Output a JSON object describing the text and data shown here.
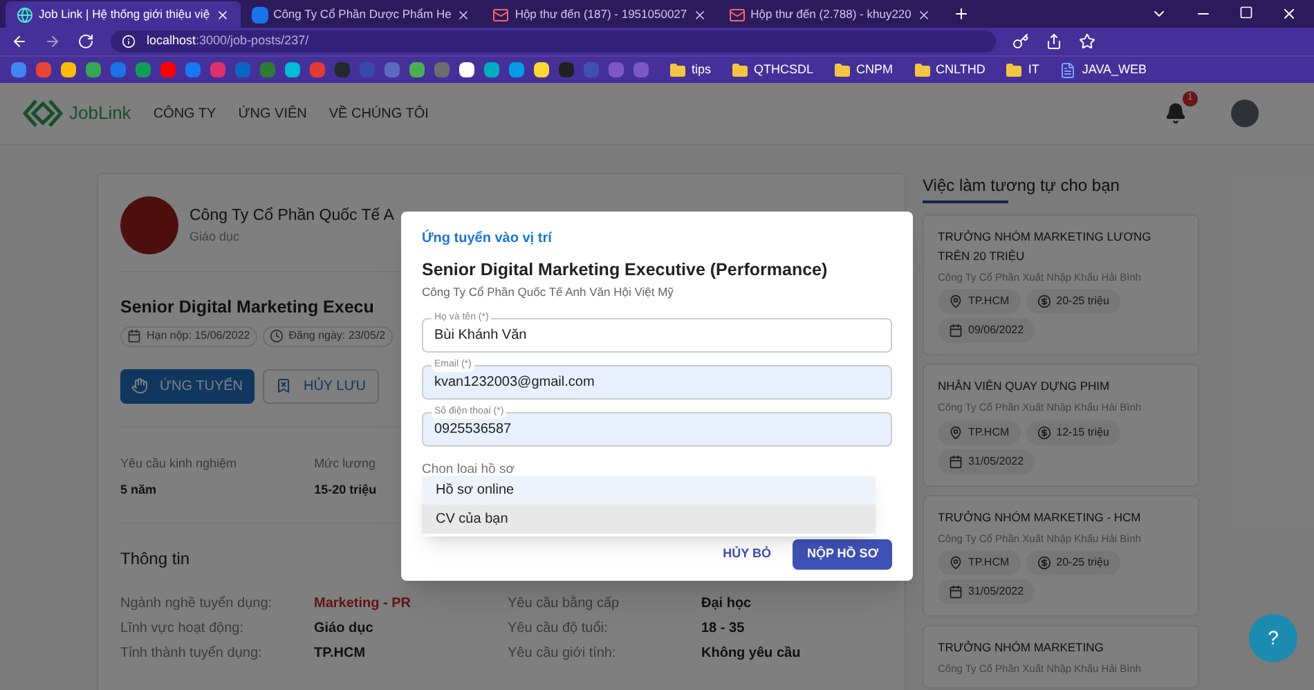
{
  "browser": {
    "tabs": [
      {
        "title": "Job Link | Hệ thống giới thiệu việ",
        "selected": true,
        "kind": "site"
      },
      {
        "title": "Công Ty Cổ Phần Dược Phẩm He",
        "selected": false,
        "kind": "word"
      },
      {
        "title": "Hộp thư đến (187) - 1951050027",
        "selected": false,
        "kind": "mail"
      },
      {
        "title": "Hộp thư đến (2.788) - khuy220",
        "selected": false,
        "kind": "mail"
      }
    ],
    "url_host": "localhost",
    "url_path": ":3000/job-posts/237/",
    "bookmarks": [
      {
        "kind": "site",
        "color": "#4285f4"
      },
      {
        "kind": "site",
        "color": "#ea4335"
      },
      {
        "kind": "site",
        "color": "#fbbc05"
      },
      {
        "kind": "site",
        "color": "#34a853"
      },
      {
        "kind": "site",
        "color": "#1a73e8"
      },
      {
        "kind": "site",
        "color": "#0f9d58"
      },
      {
        "kind": "site",
        "color": "#ff0000"
      },
      {
        "kind": "site",
        "color": "#1877f2"
      },
      {
        "kind": "site",
        "color": "#e1306c"
      },
      {
        "kind": "site",
        "color": "#0a66c2"
      },
      {
        "kind": "site",
        "color": "#2e7d32"
      },
      {
        "kind": "site",
        "color": "#00bcd4"
      },
      {
        "kind": "site",
        "color": "#e53935"
      },
      {
        "kind": "site",
        "color": "#24292e"
      },
      {
        "kind": "site",
        "color": "#3949ab"
      },
      {
        "kind": "site",
        "color": "#5c6bc0"
      },
      {
        "kind": "site",
        "color": "#4caf50"
      },
      {
        "kind": "site",
        "color": "#6d6d6d"
      },
      {
        "kind": "site",
        "color": "#ffffff"
      },
      {
        "kind": "site",
        "color": "#00acc1"
      },
      {
        "kind": "site",
        "color": "#039be5"
      },
      {
        "kind": "site",
        "color": "#fdd835"
      },
      {
        "kind": "site",
        "color": "#212121"
      },
      {
        "kind": "site",
        "color": "#3f51b5"
      },
      {
        "kind": "site",
        "color": "#7e57c2"
      },
      {
        "kind": "site",
        "color": "#7e57c2"
      },
      {
        "kind": "folder",
        "label": "tips"
      },
      {
        "kind": "folder",
        "label": "QTHCSDL"
      },
      {
        "kind": "folder",
        "label": "CNPM"
      },
      {
        "kind": "folder",
        "label": "CNLTHD"
      },
      {
        "kind": "folder",
        "label": "IT"
      },
      {
        "kind": "doc",
        "label": "JAVA_WEB"
      }
    ]
  },
  "header": {
    "logo": "JobLink",
    "nav": [
      {
        "label": "CÔNG TY"
      },
      {
        "label": "ỨNG VIÊN"
      },
      {
        "label": "VỀ CHÚNG TÔI"
      }
    ],
    "notification_count": "1"
  },
  "job": {
    "company": "Công Ty Cổ Phần Quốc Tế A",
    "industry": "Giáo dục",
    "title": "Senior Digital Marketing Execu",
    "deadline": "Hạn nộp: 15/06/2022",
    "posted": "Đăng ngày: 23/05/2",
    "actions": [
      {
        "label": "ỨNG TUYỂN",
        "kind": "primary"
      },
      {
        "label": "HỦY LƯU",
        "kind": "outlined"
      }
    ],
    "summary": [
      {
        "label": "Yêu cầu kinh nghiệm",
        "value": "5 năm"
      },
      {
        "label": "Mức lương",
        "value": "15-20 triệu"
      }
    ],
    "info_title": "Thông tin",
    "info_left": [
      {
        "label": "Ngành nghề tuyển dụng:",
        "value": "Marketing - PR",
        "highlight": true
      },
      {
        "label": "Lĩnh vực hoạt động:",
        "value": "Giáo dục",
        "highlight": false
      },
      {
        "label": "Tỉnh thành tuyển dụng:",
        "value": "TP.HCM",
        "highlight": false
      }
    ],
    "info_right": [
      {
        "label": "Yêu cầu bằng cấp",
        "value": "Đại học"
      },
      {
        "label": "Yêu cầu độ tuổi:",
        "value": "18 - 35"
      },
      {
        "label": "Yêu cầu giới tính:",
        "value": "Không yêu cầu"
      }
    ]
  },
  "similar": {
    "title": "Việc làm tương tự cho bạn",
    "jobs": [
      {
        "title": "TRƯỞNG NHÓM MARKETING LƯƠNG TRÊN 20 TRIỆU",
        "company": "Công Ty Cổ Phần Xuất Nhập Khẩu Hải Bình",
        "location": "TP.HCM",
        "salary": "20-25 triệu",
        "date": "09/06/2022"
      },
      {
        "title": "NHÂN VIÊN QUAY DỰNG PHIM",
        "company": "Công Ty Cổ Phần Xuất Nhập Khẩu Hải Bình",
        "location": "TP.HCM",
        "salary": "12-15 triệu",
        "date": "31/05/2022"
      },
      {
        "title": "TRƯỞNG NHÓM MARKETING - HCM",
        "company": "Công Ty Cổ Phần Xuất Nhập Khẩu Hải Bình",
        "location": "TP.HCM",
        "salary": "20-25 triệu",
        "date": "31/05/2022"
      },
      {
        "title": "TRƯỞNG NHÓM MARKETING",
        "company": "Công Ty Cổ Phần Xuất Nhập Khẩu Hải Bình"
      }
    ]
  },
  "help_button": "?",
  "dialog": {
    "heading": "Ứng tuyển vào vị trí",
    "job_title": "Senior Digital Marketing Executive (Performance)",
    "company": "Công Ty Cổ Phần Quốc Tế Anh Văn Hội Việt Mỹ",
    "fields": [
      {
        "label": "Họ và tên (*)",
        "value": "Bùi Khánh Văn",
        "autofilled": false
      },
      {
        "label": "Email (*)",
        "value": "kvan1232003@gmail.com",
        "autofilled": true
      },
      {
        "label": "Số điện thoại (*)",
        "value": "0925536587",
        "autofilled": true
      }
    ],
    "select_label": "Chọn loại hồ sơ",
    "options": [
      {
        "label": "Hồ sơ online",
        "selected": true,
        "hovered": false
      },
      {
        "label": "CV của bạn",
        "selected": false,
        "hovered": true
      }
    ],
    "buttons": [
      {
        "label": "HỦY BỎ",
        "kind": "text"
      },
      {
        "label": "NỘP HỒ SƠ",
        "kind": "contained"
      }
    ]
  }
}
